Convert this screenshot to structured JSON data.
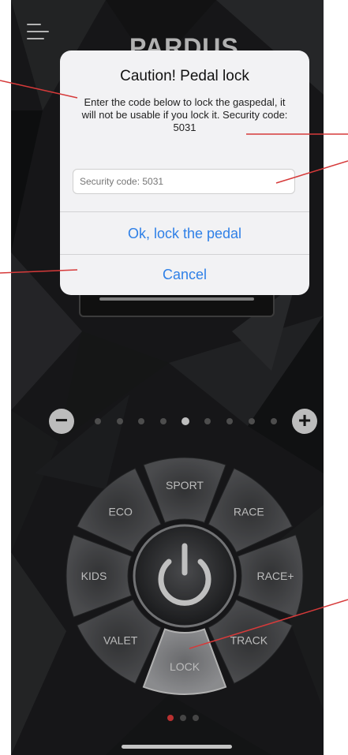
{
  "app": {
    "brand": "PARDUS"
  },
  "dialog": {
    "title": "Caution! Pedal lock",
    "message": "Enter the code below to lock the gaspedal, it will not be usable if you lock it. Security code: 5031",
    "input_placeholder": "Security code: 5031",
    "ok_label": "Ok, lock the pedal",
    "cancel_label": "Cancel"
  },
  "slider": {
    "minus_icon": "minus-icon",
    "plus_icon": "plus-icon",
    "step_count": 9,
    "active_step": 5
  },
  "modes": {
    "items": [
      {
        "label": "SPORT"
      },
      {
        "label": "RACE"
      },
      {
        "label": "RACE+"
      },
      {
        "label": "TRACK"
      },
      {
        "label": "LOCK"
      },
      {
        "label": "VALET"
      },
      {
        "label": "KIDS"
      },
      {
        "label": "ECO"
      }
    ],
    "selected": "LOCK",
    "center_icon": "power-icon"
  },
  "pager": {
    "pages": 3,
    "current": 1
  },
  "colors": {
    "accent_blue": "#2f80e7",
    "page_indicator_active": "#e23b3b",
    "annotation_line": "#d63a3a"
  },
  "icons": {
    "menu": "hamburger-menu-icon"
  }
}
